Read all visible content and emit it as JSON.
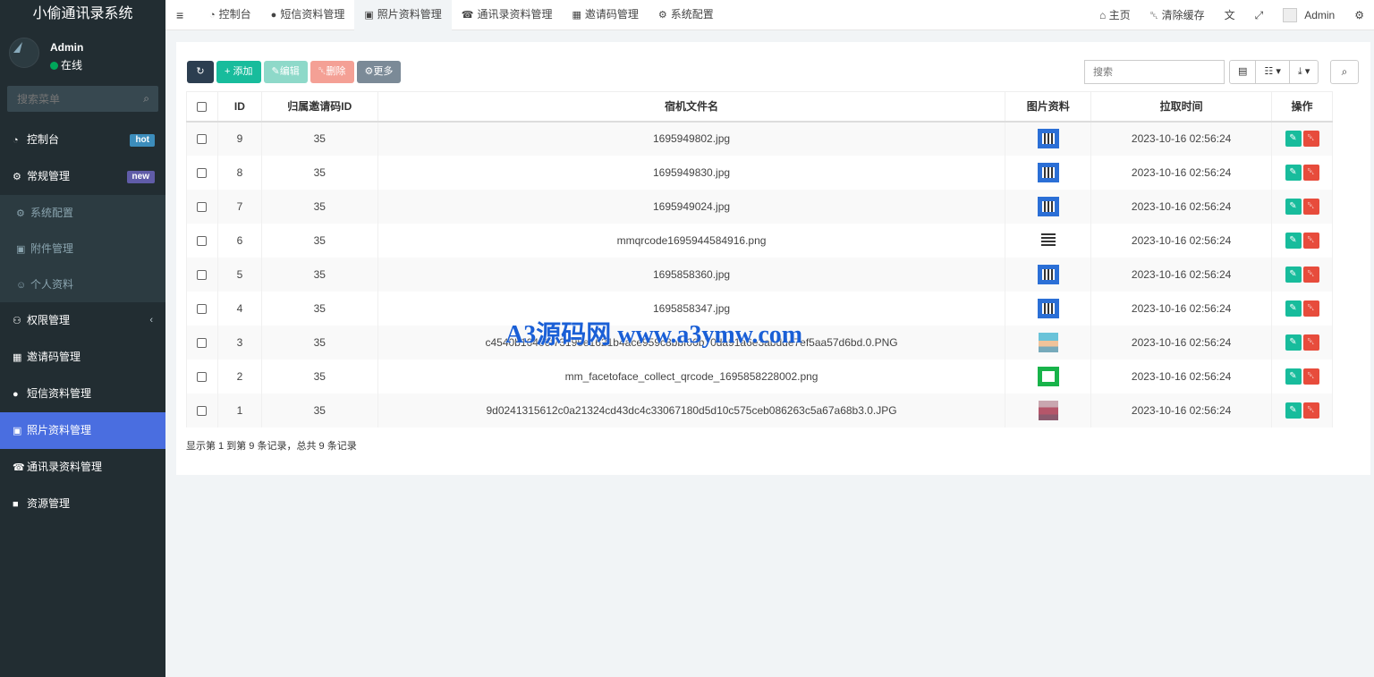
{
  "app": {
    "title": "小偷通讯录系统"
  },
  "user": {
    "name": "Admin",
    "status": "在线"
  },
  "sidebar": {
    "search_placeholder": "搜索菜单",
    "items": [
      {
        "label": "控制台",
        "icon": "dashboard-icon",
        "badge": "hot"
      },
      {
        "label": "常规管理",
        "icon": "cogs-icon",
        "badge": "new"
      },
      {
        "label": "系统配置",
        "icon": "gear-icon",
        "sub": true
      },
      {
        "label": "附件管理",
        "icon": "image-icon",
        "sub": true
      },
      {
        "label": "个人资料",
        "icon": "user-icon",
        "sub": true
      },
      {
        "label": "权限管理",
        "icon": "group-icon"
      },
      {
        "label": "邀请码管理",
        "icon": "qrcode-icon"
      },
      {
        "label": "短信资料管理",
        "icon": "comments-icon"
      },
      {
        "label": "照片资料管理",
        "icon": "image-icon",
        "active": true
      },
      {
        "label": "通讯录资料管理",
        "icon": "phone-icon"
      },
      {
        "label": "资源管理",
        "icon": "video-icon"
      }
    ]
  },
  "topnav": {
    "tabs": [
      {
        "label": "控制台",
        "icon": "dashboard-icon"
      },
      {
        "label": "短信资料管理",
        "icon": "comments-icon"
      },
      {
        "label": "照片资料管理",
        "icon": "image-icon",
        "active": true
      },
      {
        "label": "通讯录资料管理",
        "icon": "phone-icon"
      },
      {
        "label": "邀请码管理",
        "icon": "qrcode-icon"
      },
      {
        "label": "系统配置",
        "icon": "gear-icon"
      }
    ],
    "home": "主页",
    "clear_cache": "清除缓存",
    "admin": "Admin"
  },
  "toolbar": {
    "add": "添加",
    "edit": "编辑",
    "delete": "删除",
    "more": "更多",
    "search_placeholder": "搜索"
  },
  "table": {
    "headers": [
      "ID",
      "归属邀请码ID",
      "宿机文件名",
      "图片资料",
      "拉取时间",
      "操作"
    ],
    "rows": [
      {
        "id": "9",
        "code": "35",
        "file": "1695949802.jpg",
        "thumb": "qr",
        "time": "2023-10-16 02:56:24"
      },
      {
        "id": "8",
        "code": "35",
        "file": "1695949830.jpg",
        "thumb": "qr",
        "time": "2023-10-16 02:56:24"
      },
      {
        "id": "7",
        "code": "35",
        "file": "1695949024.jpg",
        "thumb": "qr",
        "time": "2023-10-16 02:56:24"
      },
      {
        "id": "6",
        "code": "35",
        "file": "mmqrcode1695944584916.png",
        "thumb": "mm",
        "time": "2023-10-16 02:56:24"
      },
      {
        "id": "5",
        "code": "35",
        "file": "1695858360.jpg",
        "thumb": "qr",
        "time": "2023-10-16 02:56:24"
      },
      {
        "id": "4",
        "code": "35",
        "file": "1695858347.jpg",
        "thumb": "qr",
        "time": "2023-10-16 02:56:24"
      },
      {
        "id": "3",
        "code": "35",
        "file": "c4540b16466f73195e1621b4ace959c8bbf06b70da91a6e3abdde7ef5aa57d6bd.0.PNG",
        "thumb": "face1",
        "time": "2023-10-16 02:56:24"
      },
      {
        "id": "2",
        "code": "35",
        "file": "mm_facetoface_collect_qrcode_1695858228002.png",
        "thumb": "green",
        "time": "2023-10-16 02:56:24"
      },
      {
        "id": "1",
        "code": "35",
        "file": "9d0241315612c0a21324cd43dc4c33067180d5d10c575ceb086263c5a67a68b3.0.JPG",
        "thumb": "face2",
        "time": "2023-10-16 02:56:24"
      }
    ]
  },
  "pager": {
    "info": "显示第 1 到第 9 条记录，总共 9 条记录"
  },
  "watermark": "A3源码网 www.a3ymw.com",
  "colors": {
    "sidebar": "#222d32",
    "active": "#4a6ee0",
    "add": "#18bc9c",
    "delete": "#e74c3c"
  }
}
